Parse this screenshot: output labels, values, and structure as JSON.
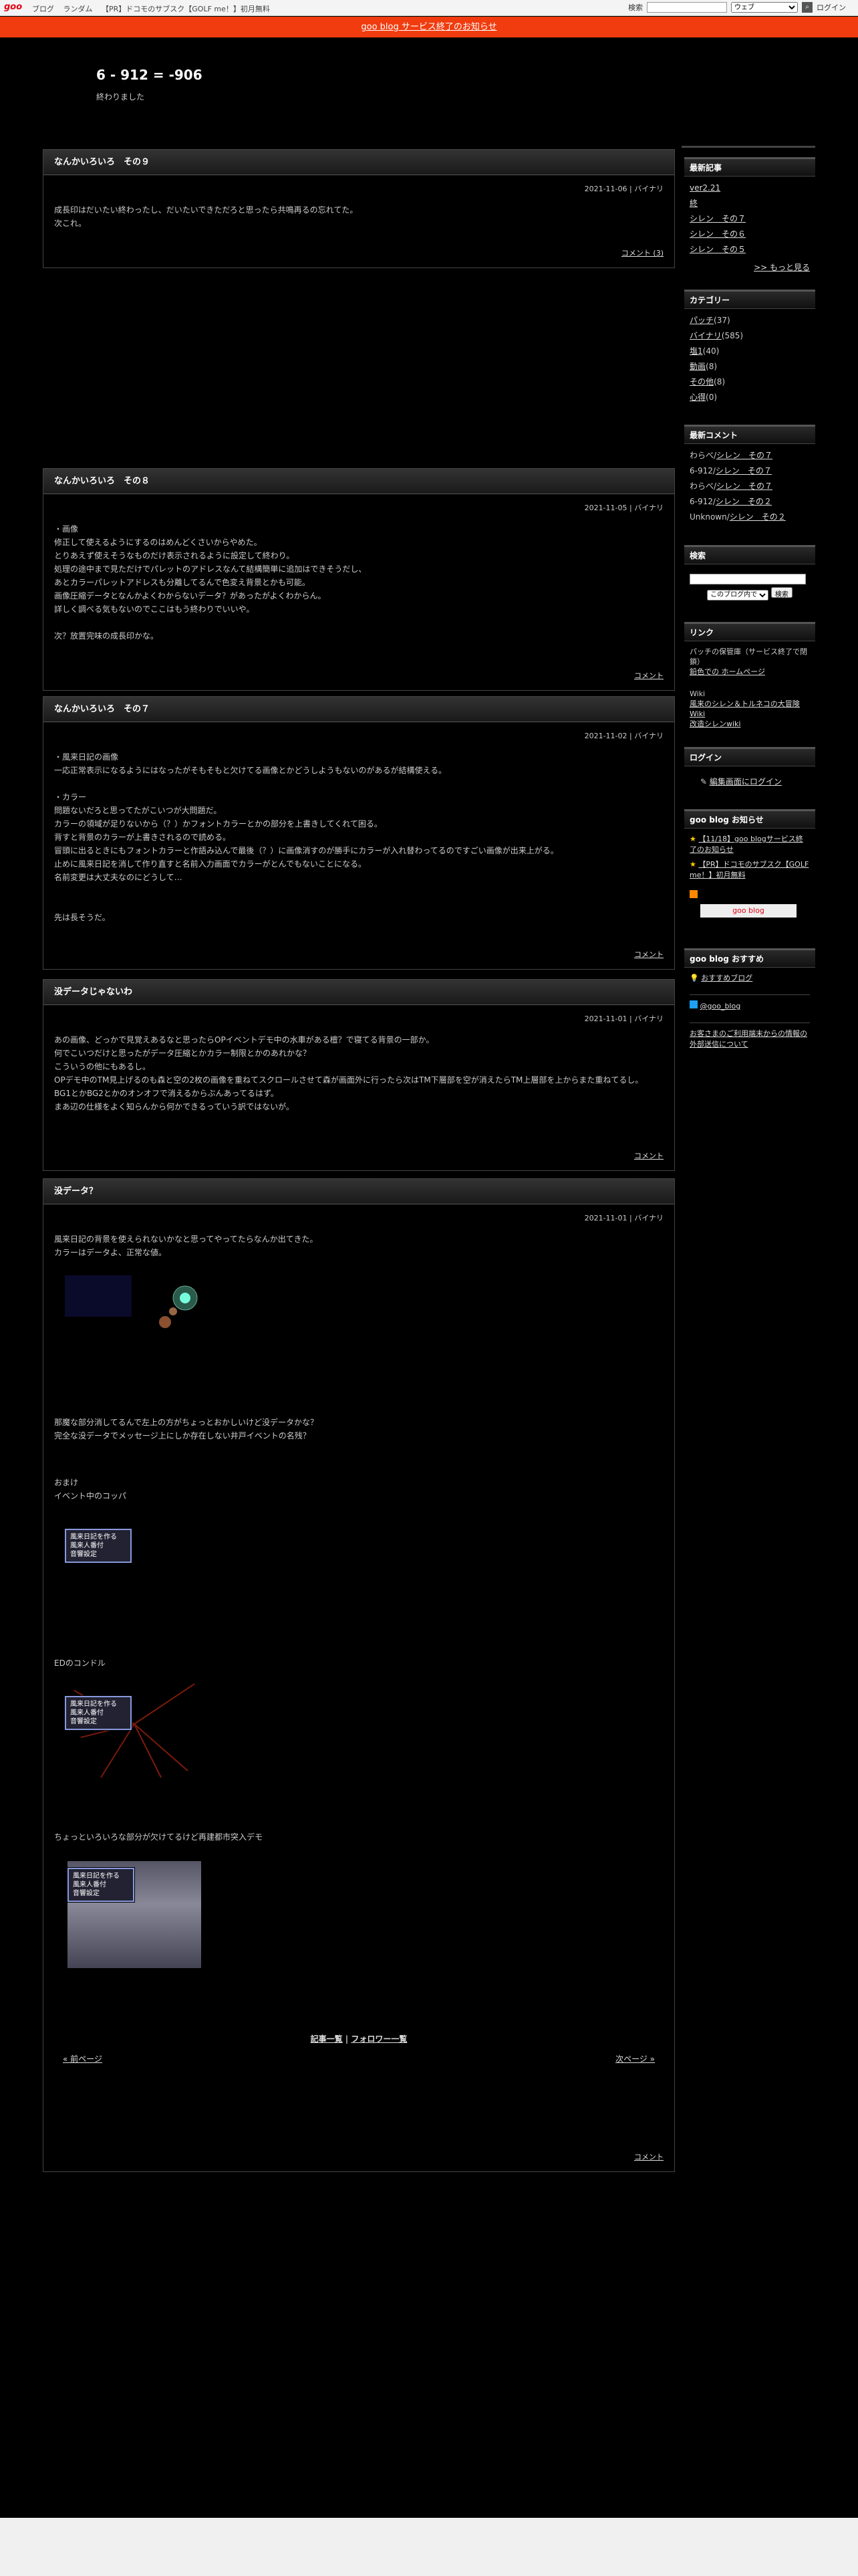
{
  "topbar": {
    "logo": "goo",
    "nav": [
      "ブログ",
      "ランダム",
      "【PR】ドコモのサブスク【GOLF me！】初月無料"
    ],
    "search_label": "検索",
    "search_select": "ウェブ",
    "login": "ログイン"
  },
  "notice": "goo blog サービス終了のお知らせ",
  "blog": {
    "title": "6 - 912 = -906",
    "subtitle": "終わりました"
  },
  "entries": [
    {
      "title": "なんかいろいろ　その９",
      "meta": "2021-11-06 | バイナリ",
      "body": "成長印はだいたい終わったし、だいたいできただろと思ったら共鳴再るの忘れてた。\n次これ。",
      "footer": "コメント (3)"
    },
    {
      "title": "なんかいろいろ　その８",
      "meta": "2021-11-05 | バイナリ",
      "body": "・画像\n修正して使えるようにするのはめんどくさいからやめた。\nとりあえず使えそうなものだけ表示されるように設定して終わり。\n処理の途中まで見ただけでパレットのアドレスなんて結構簡単に追加はできそうだし、\nあとカラーパレットアドレスも分離してるんで色変え背景とかも可能。\n画像圧縮データとなんかよくわからないデータ？があったがよくわからん。\n詳しく調べる気もないのでここはもう終わりでいいや。\n\n次？放置完味の成長印かな。",
      "footer": "コメント"
    },
    {
      "title": "なんかいろいろ　その７",
      "meta": "2021-11-02 | バイナリ",
      "body": "・風来日記の画像\n一応正常表示になるようにはなったがそもそもと欠けてる画像とかどうしようもないのがあるが結構使える。\n\n・カラー\n問題ないだろと思ってたがこいつが大問題だ。\nカラーの領域が足りないから（？）かフォントカラーとかの部分を上書きしてくれて困る。\n背すと背景のカラーが上書きされるので読める。\n冒頭に出るときにもフォントカラーと作語み込んで最後（？）に画像消すのが勝手にカラーが入れ替わってるのですごい画像が出来上がる。\n止めに風来日記を消して作り直すと名前入力画面でカラーがとんでもないことになる。\n名前変更は大丈夫なのにどうして…\n\n\n先は長そうだ。",
      "footer": "コメント"
    },
    {
      "title": "没データじゃないわ",
      "meta": "2021-11-01 | バイナリ",
      "body": "あの画像、どっかで見覚えあるなと思ったらOPイベントデモ中の水車がある檀？で寝てる背景の一部か。\n何でこいつだけと思ったがデータ圧縮とかカラー制限とかのあれかな？\nこういうの他にもあるし。\nOPデモ中のTM見上げるのも森と空の2枚の画像を重ねてスクロールさせて森が画面外に行ったら次はTM下層部を空が消えたらTM上層部を上からまた重ねてるし。\nBG1とかBG2とかのオンオフで消えるからぶんあってるはず。\nまあ辺の仕様をよく知らんから何かできるっていう訳ではないが。",
      "footer": "コメント"
    },
    {
      "title": "没データ？",
      "meta": "2021-11-01 | バイナリ",
      "body": "風来日記の背景を使えられないかなと思ってやってたらなんか出てきた。\nカラーはデータよ、正常な値。",
      "body2": "那魔な部分消してるんで左上の方がちょっとおかしいけど没データかな？\n完全な没データでメッセージ上にしか存在しない井戸イベントの名残？",
      "body3": "おまけ\nイベント中のコッパ",
      "body4": "EDのコンドル",
      "body5": "ちょっといろいろな部分が欠けてるけど再建都市突入デモ",
      "menu": [
        "風来日記を作る",
        "風来人番付",
        "音響設定"
      ],
      "footer": "コメント"
    }
  ],
  "footer_links": {
    "list": "記事一覧",
    "sep": "|",
    "follow": "フォロワー一覧"
  },
  "pager": {
    "prev": "« 前ページ",
    "next": "次ページ »"
  },
  "sidebar": {
    "recent": {
      "title": "最新記事",
      "items": [
        "ver2.21",
        "終",
        "シレン　その７",
        "シレン　その６",
        "シレン　その５"
      ],
      "more": ">> もっと見る"
    },
    "category": {
      "title": "カテゴリー",
      "items": [
        {
          "name": "パッチ",
          "count": "(37)"
        },
        {
          "name": "バイナリ",
          "count": "(585)"
        },
        {
          "name": "塩1",
          "count": "(40)"
        },
        {
          "name": "動画",
          "count": "(8)"
        },
        {
          "name": "その他",
          "count": "(8)"
        },
        {
          "name": "心得",
          "count": "(0)"
        }
      ]
    },
    "comments": {
      "title": "最新コメント",
      "items": [
        {
          "who": "わらべ/",
          "link": "シレン　その７"
        },
        {
          "who": "6-912/",
          "link": "シレン　その７"
        },
        {
          "who": "わらべ/",
          "link": "シレン　その７"
        },
        {
          "who": "6-912/",
          "link": "シレン　その２"
        },
        {
          "who": "Unknown/",
          "link": "シレン　その２"
        }
      ]
    },
    "search": {
      "title": "検索",
      "select": "このブログ内で",
      "button": "検索"
    },
    "links": {
      "title": "リンク",
      "items": [
        "パッチの保管庫（サービス終了で閉鎖）",
        "鉛色での ホームページ",
        "Wiki",
        "風来のシレン＆トルネコの大冒険 Wiki",
        "改造シレンwiki"
      ]
    },
    "login": {
      "title": "ログイン",
      "edit": "編集画面にログイン"
    },
    "goo_notice": {
      "title": "goo blog お知らせ",
      "items": [
        "【11/18】goo blogサービス終了のお知らせ",
        "【PR】ドコモのサブスク【GOLF me！】初月無料"
      ],
      "logo": "goo blog"
    },
    "recommend": {
      "title": "goo blog おすすめ",
      "item": "おすすめブログ",
      "twitter": "@goo_blog",
      "notice": "お客さまのご利用端末からの情報の外部送信について"
    }
  }
}
